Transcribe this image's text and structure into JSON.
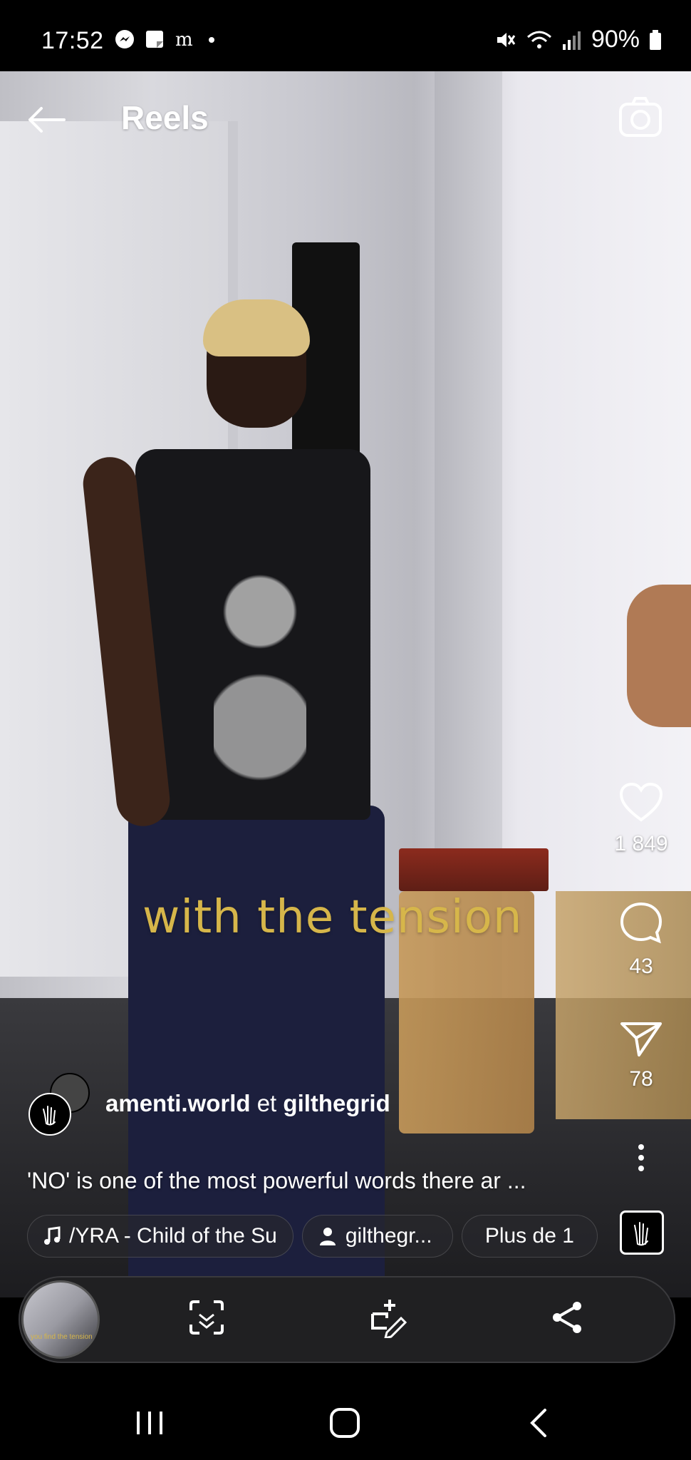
{
  "status_bar": {
    "time": "17:52",
    "battery": "90%",
    "notification_icons": [
      "messenger-icon",
      "notes-icon",
      "medium-icon",
      "dot-icon"
    ],
    "right_icons": [
      "mute-icon",
      "wifi-icon",
      "signal-icon",
      "battery-icon"
    ]
  },
  "header": {
    "title": "Reels",
    "back_icon": "arrow-left-icon",
    "camera_icon": "camera-icon"
  },
  "video": {
    "caption_overlay": "with the tension"
  },
  "actions": {
    "likes": "1 849",
    "comments": "43",
    "shares": "78"
  },
  "post": {
    "author_primary": "amenti.world",
    "author_joiner": "et",
    "author_secondary": "gilthegrid",
    "description": "'NO' is one of the most powerful words there ar ...",
    "music_chip": "/YRA - Child of the Su",
    "tag_chip": "gilthegr...",
    "more_chip": "Plus de 1"
  },
  "bottom_bar": {
    "icons": [
      "scan-icon",
      "remix-edit-icon",
      "share-icon"
    ],
    "thumb_caption": "you find the tension"
  },
  "colors": {
    "caption_gold": "#d6b64a",
    "background": "#000000",
    "pill": "#202022"
  }
}
